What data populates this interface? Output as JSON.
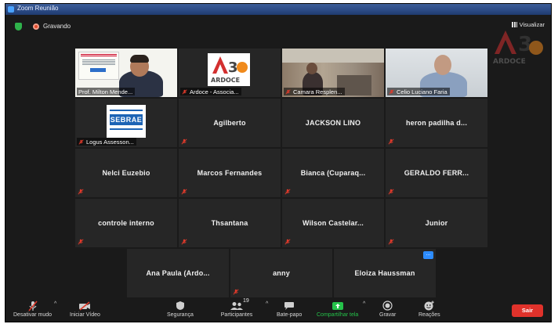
{
  "window": {
    "title": "Zoom Reunião"
  },
  "recording": {
    "label": "Gravando"
  },
  "view": {
    "label": "Visualizar"
  },
  "tiles": [
    {
      "name": "Prof. Milton Mende...",
      "active": true
    },
    {
      "name": "Ardoce - Associa..."
    },
    {
      "name": "Camara Resplen..."
    },
    {
      "name": "Celio Luciano Faria"
    },
    {
      "name": "Logus Assesson..."
    },
    {
      "name": "Agilberto"
    },
    {
      "name": "JACKSON LINO"
    },
    {
      "name": "heron padilha d..."
    },
    {
      "name": "Nelci Euzebio"
    },
    {
      "name": "Marcos Fernandes"
    },
    {
      "name": "Bianca (Cuparaq..."
    },
    {
      "name": "GERALDO FERR..."
    },
    {
      "name": "controle interno"
    },
    {
      "name": "Thsantana"
    },
    {
      "name": "Wilson Castelar..."
    },
    {
      "name": "Junior"
    },
    {
      "name": "Ana Paula (Ardo..."
    },
    {
      "name": "anny"
    },
    {
      "name": "Eloiza Haussman"
    }
  ],
  "logos": {
    "ardoce": "ARDOCE",
    "a36": "A36",
    "sebrae": "SEBRAE",
    "slide_title": "CONTROLE INTERNO"
  },
  "toolbar": {
    "mute": "Desativar mudo",
    "video": "Iniciar Vídeo",
    "security": "Segurança",
    "participants": "Participantes",
    "participants_count": "19",
    "chat": "Bate-papo",
    "share": "Compartilhar tela",
    "record": "Gravar",
    "reactions": "Reações",
    "leave": "Sair",
    "tile_more": "..."
  },
  "colors": {
    "active_speaker": "#c9e63a",
    "share_green": "#25c24a",
    "leave_red": "#e0322b",
    "muted_red": "#e03a2b"
  }
}
